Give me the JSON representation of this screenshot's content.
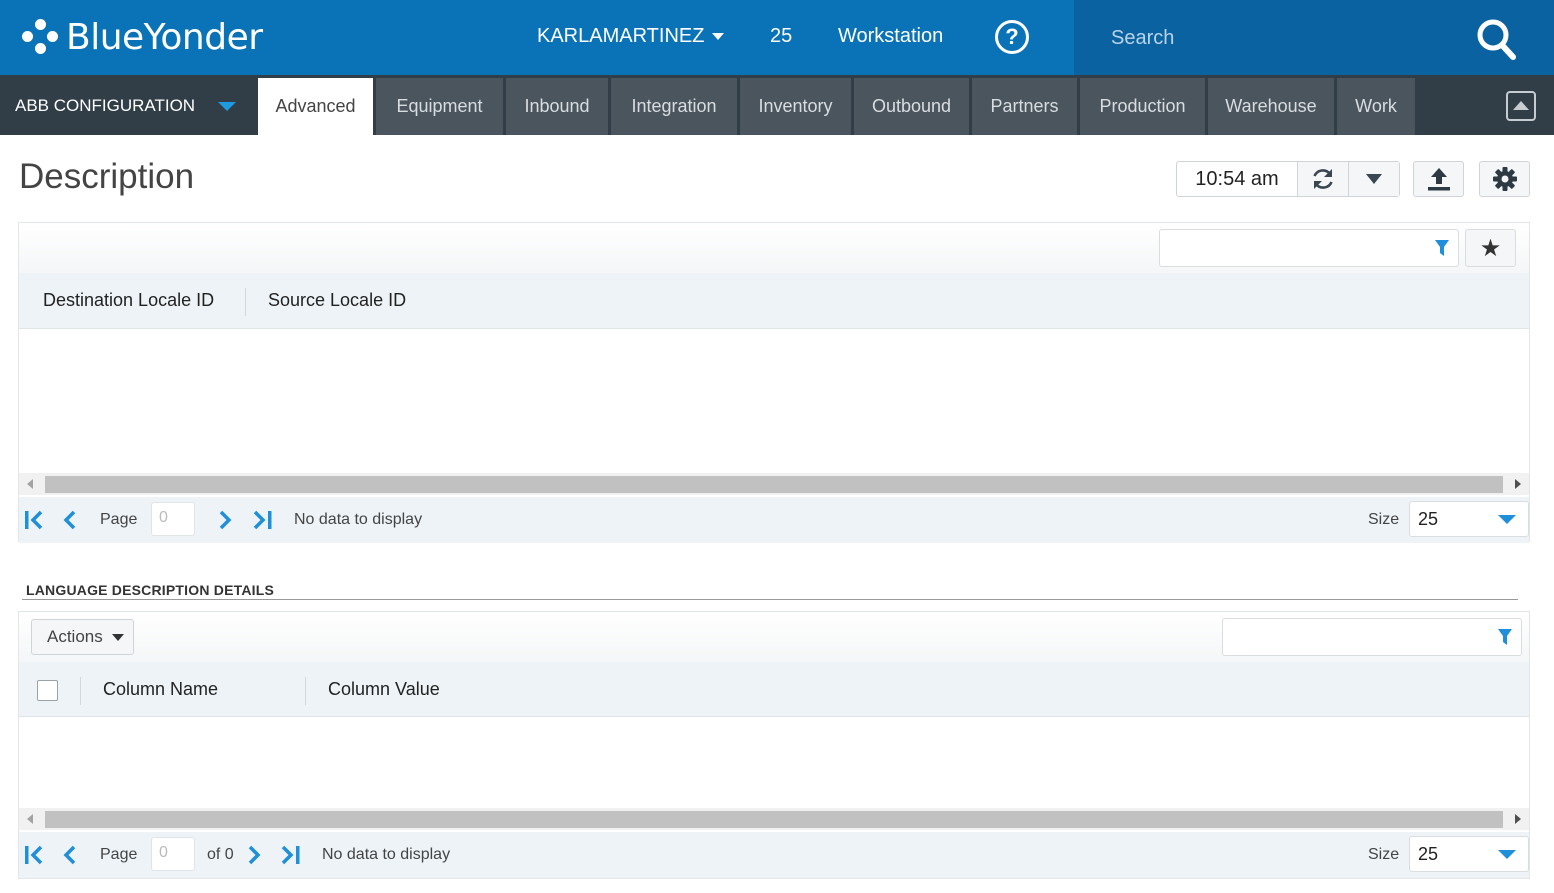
{
  "app": {
    "brand": "BlueYonder"
  },
  "top": {
    "user": "KARLAMARTINEZ",
    "count": "25",
    "workstation": "Workstation",
    "search_placeholder": "Search"
  },
  "nav": {
    "config": "ABB CONFIGURATION",
    "tabs": [
      "Advanced",
      "Equipment",
      "Inbound",
      "Integration",
      "Inventory",
      "Outbound",
      "Partners",
      "Production",
      "Warehouse",
      "Work"
    ],
    "active_tab": "Advanced"
  },
  "page": {
    "title": "Description",
    "time": "10:54 am"
  },
  "grid1": {
    "columns": [
      "Destination Locale ID",
      "Source Locale ID"
    ],
    "pager": {
      "page_label": "Page",
      "page_value": "0",
      "status": "No data to display",
      "size_label": "Size",
      "size_value": "25"
    }
  },
  "section": {
    "title": "LANGUAGE DESCRIPTION DETAILS"
  },
  "grid2": {
    "actions_label": "Actions",
    "columns": [
      "Column Name",
      "Column Value"
    ],
    "pager": {
      "page_label": "Page",
      "page_value": "0",
      "of_label": "of 0",
      "status": "No data to display",
      "size_label": "Size",
      "size_value": "25"
    }
  },
  "colors": {
    "topbar": "#0a73b7",
    "navbar": "#313e48",
    "tab": "#4a555e",
    "accent": "#1e8fd8"
  }
}
